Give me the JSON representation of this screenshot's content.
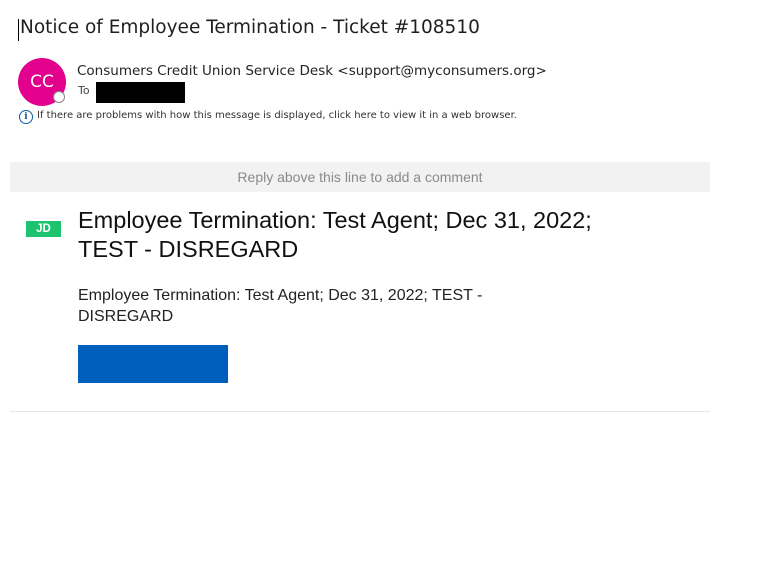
{
  "email": {
    "subject": "Notice of Employee Termination - Ticket #108510",
    "sender": {
      "initials": "CC",
      "display": "Consumers Credit Union Service Desk <support@myconsumers.org>",
      "avatar_color": "#e3008c"
    },
    "to_label": "To",
    "info_icon_glyph": "i",
    "info_message": "If there are problems with how this message is displayed, click here to view it in a web browser."
  },
  "body": {
    "reply_line": "Reply above this line to add a comment",
    "agent_initials": "JD",
    "agent_badge_color": "#1ec370",
    "ticket_title": "Employee Termination: Test Agent; Dec 31, 2022; TEST - DISREGARD",
    "ticket_description": "Employee Termination: Test Agent; Dec 31, 2022; TEST - DISREGARD",
    "button_color": "#005fbd"
  }
}
